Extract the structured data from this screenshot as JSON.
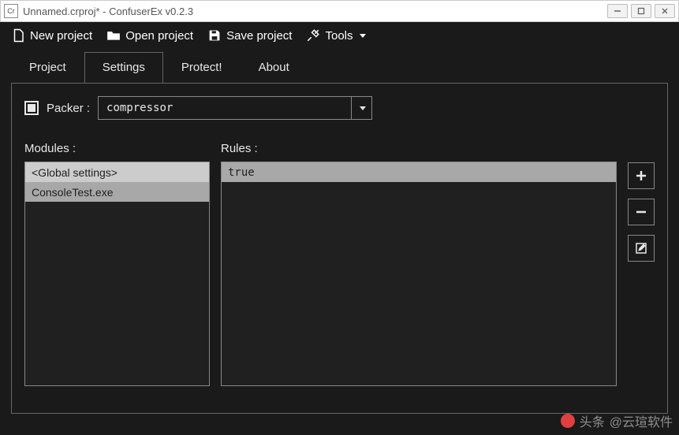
{
  "window": {
    "title": "Unnamed.crproj* - ConfuserEx v0.2.3",
    "icon_text": "Cr"
  },
  "toolbar": {
    "new_project": "New project",
    "open_project": "Open project",
    "save_project": "Save project",
    "tools": "Tools"
  },
  "tabs": {
    "project": "Project",
    "settings": "Settings",
    "protect": "Protect!",
    "about": "About",
    "active": "settings"
  },
  "packer": {
    "label": "Packer :",
    "checked": true,
    "value": "compressor"
  },
  "modules": {
    "label": "Modules :",
    "items": [
      "<Global settings>",
      "ConsoleTest.exe"
    ],
    "selected_index": 0
  },
  "rules": {
    "label": "Rules :",
    "items": [
      "true"
    ],
    "selected_index": 0
  },
  "watermark": {
    "site": "头条",
    "user": "@云瑄软件"
  }
}
